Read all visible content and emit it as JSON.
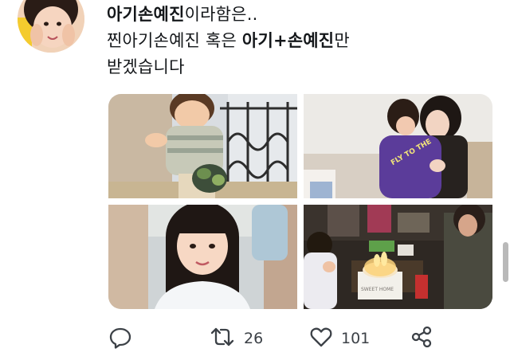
{
  "tweet": {
    "line1_bold": "아기손예진",
    "line1_rest": "이라함은..",
    "line2_start": "찐아기손예진 혹은 ",
    "line2_bold": "아기+손예진",
    "line2_end": "만",
    "line3": "받겠습니다",
    "sign_text": "FLY TO THE",
    "box_text": "SWEET HOME"
  },
  "actions": {
    "reply_icon": "reply-icon",
    "retweet_icon": "retweet-icon",
    "retweet_count": "26",
    "like_icon": "heart-icon",
    "like_count": "101",
    "share_icon": "share-icon"
  },
  "colors": {
    "text": "#14171a",
    "icon": "#3c4147"
  }
}
